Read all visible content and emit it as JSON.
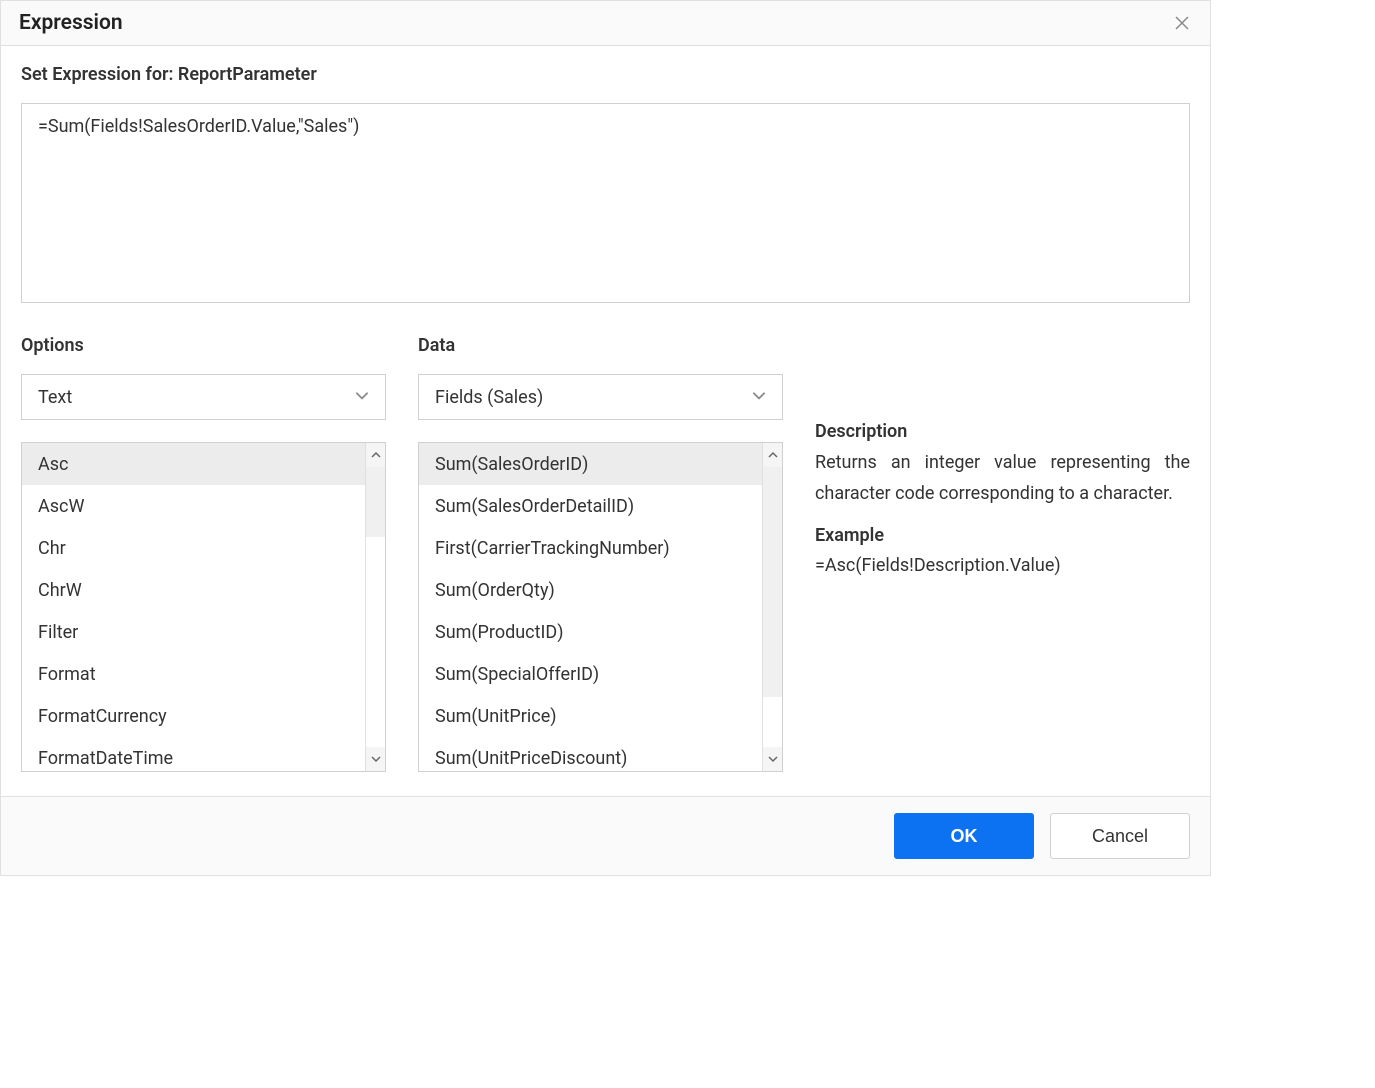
{
  "dialog": {
    "title": "Expression",
    "set_label": "Set Expression for: ReportParameter",
    "expression_value": "=Sum(Fields!SalesOrderID.Value,\"Sales\")"
  },
  "options": {
    "label": "Options",
    "selected": "Text",
    "items": [
      "Asc",
      "AscW",
      "Chr",
      "ChrW",
      "Filter",
      "Format",
      "FormatCurrency",
      "FormatDateTime"
    ]
  },
  "data": {
    "label": "Data",
    "selected": "Fields (Sales)",
    "items": [
      "Sum(SalesOrderID)",
      "Sum(SalesOrderDetailID)",
      "First(CarrierTrackingNumber)",
      "Sum(OrderQty)",
      "Sum(ProductID)",
      "Sum(SpecialOfferID)",
      "Sum(UnitPrice)",
      "Sum(UnitPriceDiscount)"
    ]
  },
  "description": {
    "heading": "Description",
    "text": "Returns an integer value representing the character code corresponding to a character.",
    "example_heading": "Example",
    "example_text": "=Asc(Fields!Description.Value)"
  },
  "footer": {
    "ok": "OK",
    "cancel": "Cancel"
  }
}
